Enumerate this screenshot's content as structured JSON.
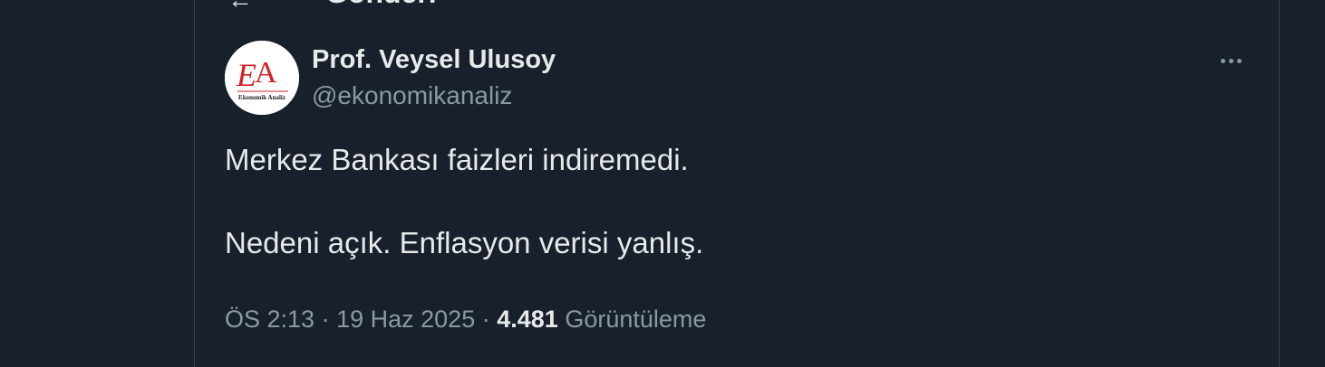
{
  "header": {
    "title": "Gönderi"
  },
  "tweet": {
    "author_name": "Prof. Veysel Ulusoy",
    "author_handle": "@ekonomikanaliz",
    "avatar": {
      "logo_letters": "EA",
      "logo_caption": "Ekonomik Analiz",
      "colors": {
        "primary": "#d32027",
        "background": "#ffffff",
        "caption": "#222222"
      }
    },
    "text_lines": [
      "Merkez Bankası faizleri indiremedi.",
      "Nedeni açık. Enflasyon verisi yanlış."
    ],
    "time": "ÖS 2:13",
    "separator": "·",
    "date": "19 Haz 2025",
    "views_count": "4.481",
    "views_label": "Görüntüleme",
    "more_icon": "ellipsis-icon"
  },
  "colors": {
    "background": "#17202b",
    "border": "#38444d",
    "primary_text": "#e7e9ea",
    "secondary_text": "#8b98a5"
  }
}
